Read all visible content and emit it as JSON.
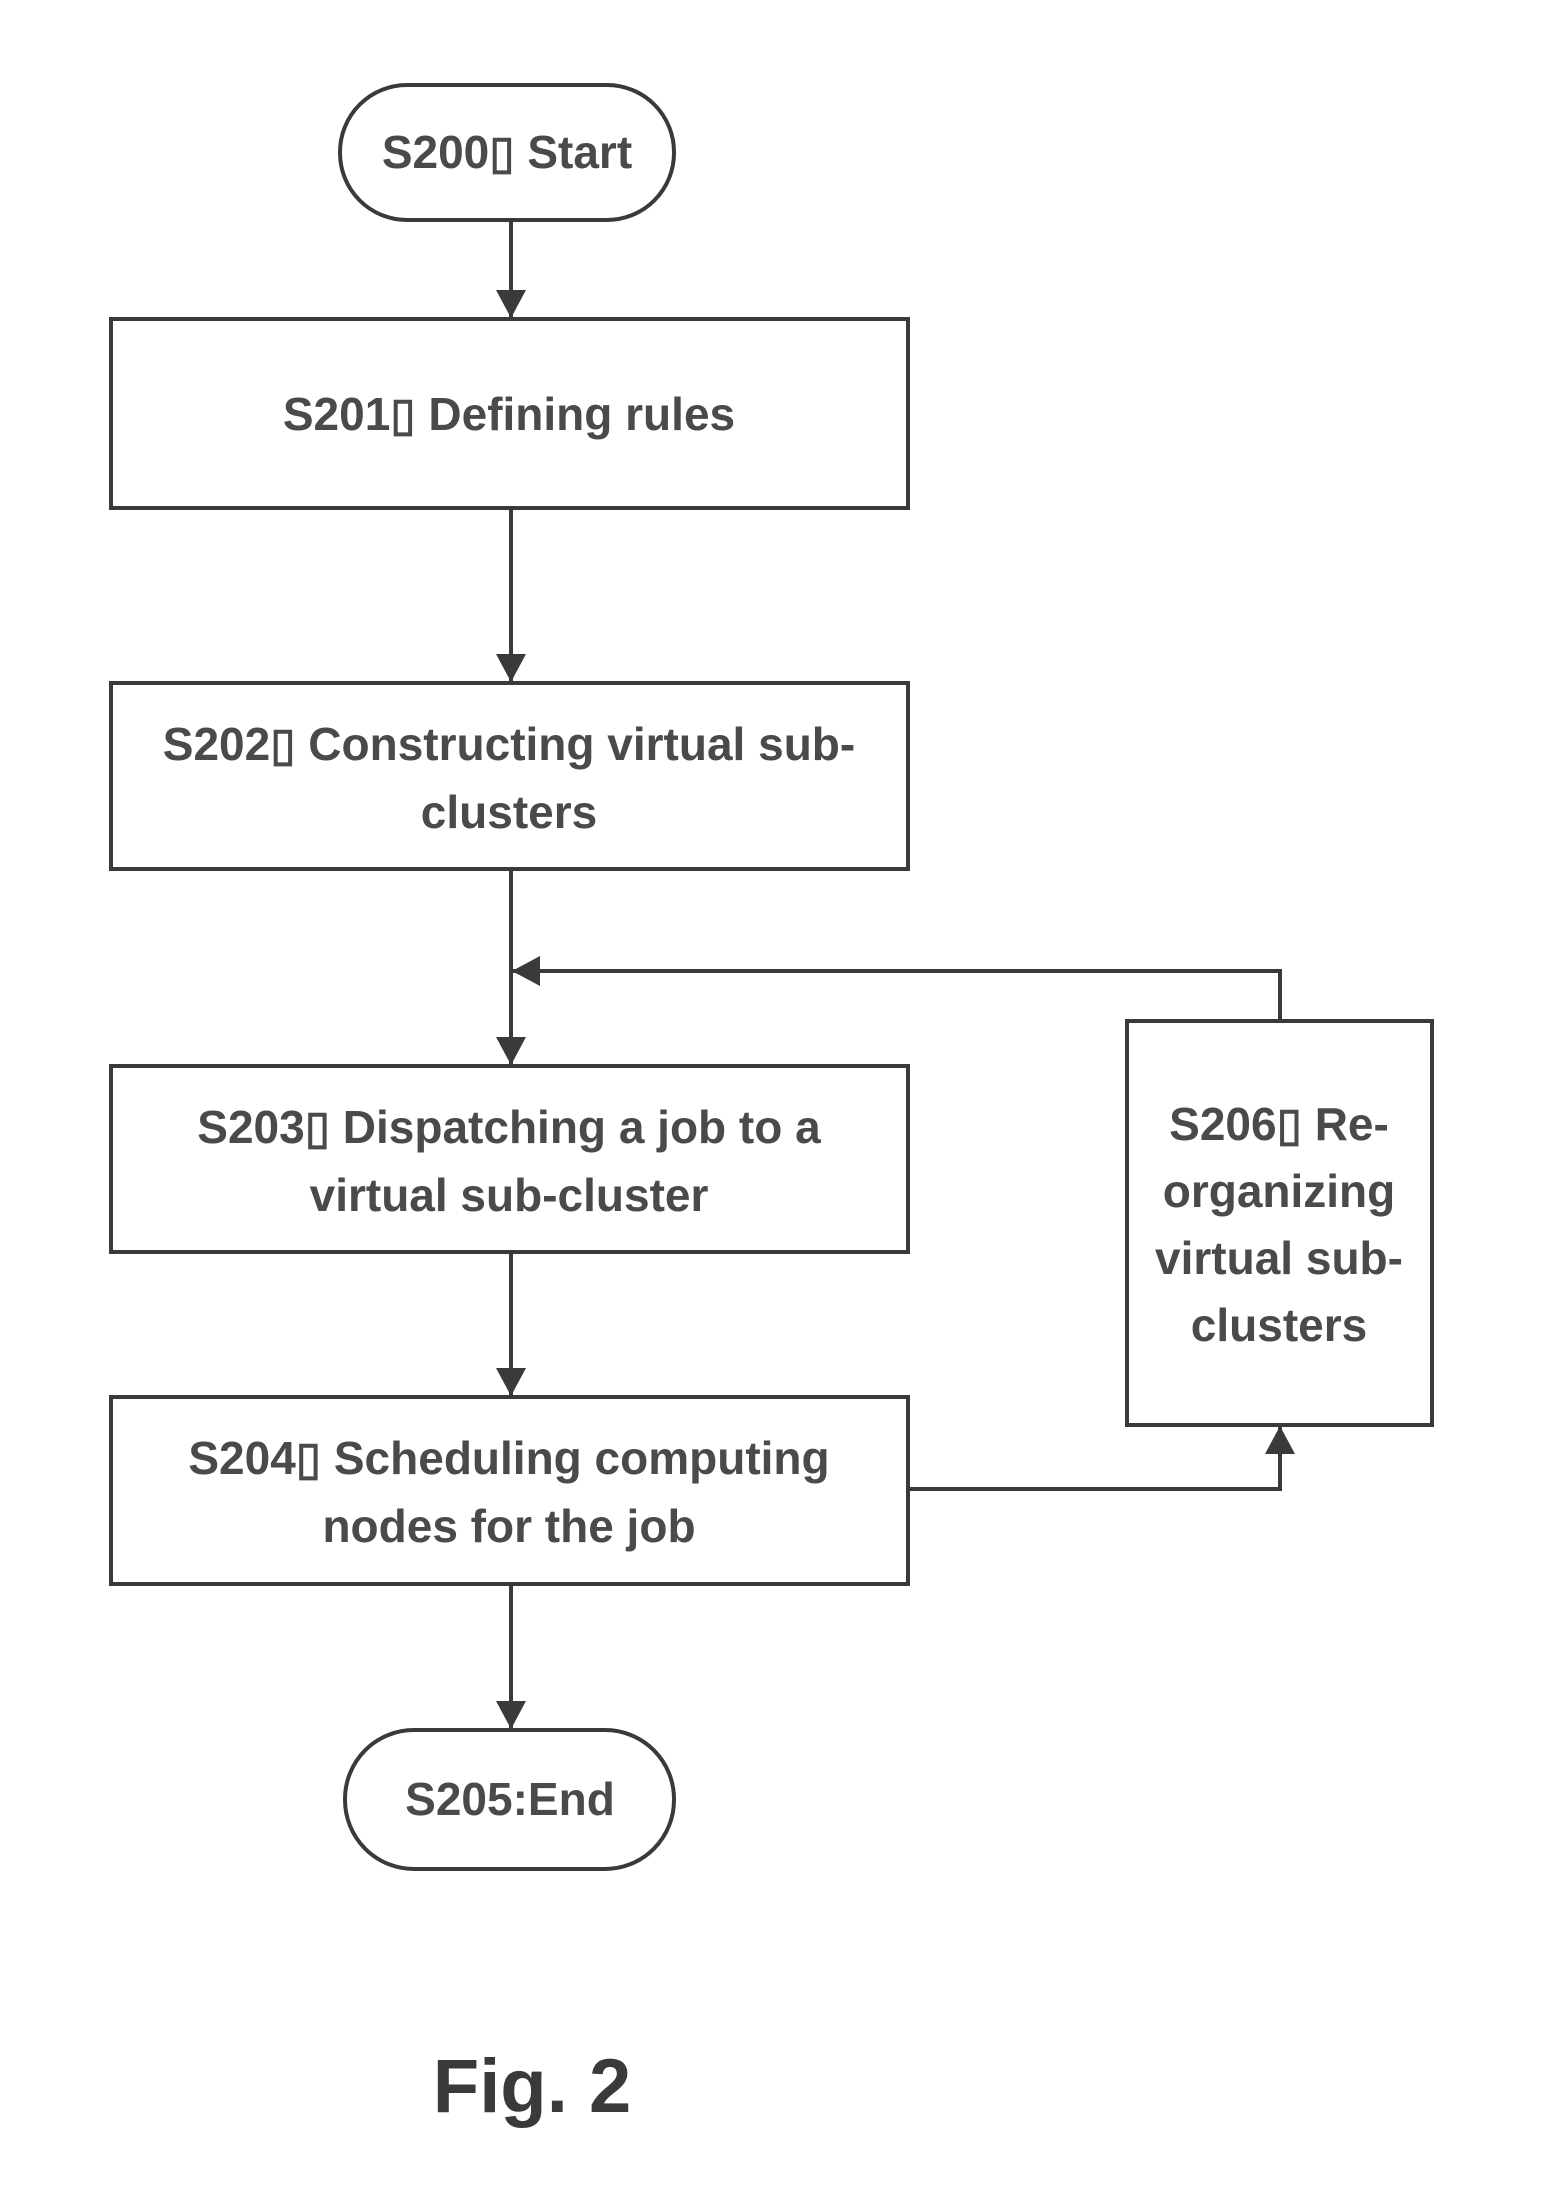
{
  "figure": {
    "caption": "Fig. 2",
    "colors": {
      "stroke": "#3a3a3a",
      "text": "#4a4a4a",
      "background": "#ffffff"
    }
  },
  "nodes": [
    {
      "id": "S200",
      "type": "terminal",
      "lines": [
        "S200▯   Start"
      ]
    },
    {
      "id": "S201",
      "type": "process",
      "lines": [
        "S201▯   Defining rules"
      ]
    },
    {
      "id": "S202",
      "type": "process",
      "lines": [
        "S202▯   Constructing virtual sub-",
        "clusters"
      ]
    },
    {
      "id": "S203",
      "type": "process",
      "lines": [
        "S203▯   Dispatching a job to a",
        "virtual sub-cluster"
      ]
    },
    {
      "id": "S204",
      "type": "process",
      "lines": [
        "S204▯   Scheduling computing",
        "nodes for the job"
      ]
    },
    {
      "id": "S205",
      "type": "terminal",
      "lines": [
        "S205:End"
      ]
    },
    {
      "id": "S206",
      "type": "process",
      "lines": [
        "S206▯   Re-",
        "organizing",
        "virtual sub-",
        "clusters"
      ]
    }
  ],
  "edges": [
    {
      "from": "S200",
      "to": "S201"
    },
    {
      "from": "S201",
      "to": "S202"
    },
    {
      "from": "S202",
      "to": "S203"
    },
    {
      "from": "S203",
      "to": "S204"
    },
    {
      "from": "S204",
      "to": "S205"
    },
    {
      "from": "S204",
      "to": "S206"
    },
    {
      "from": "S206",
      "to": "S203"
    }
  ]
}
